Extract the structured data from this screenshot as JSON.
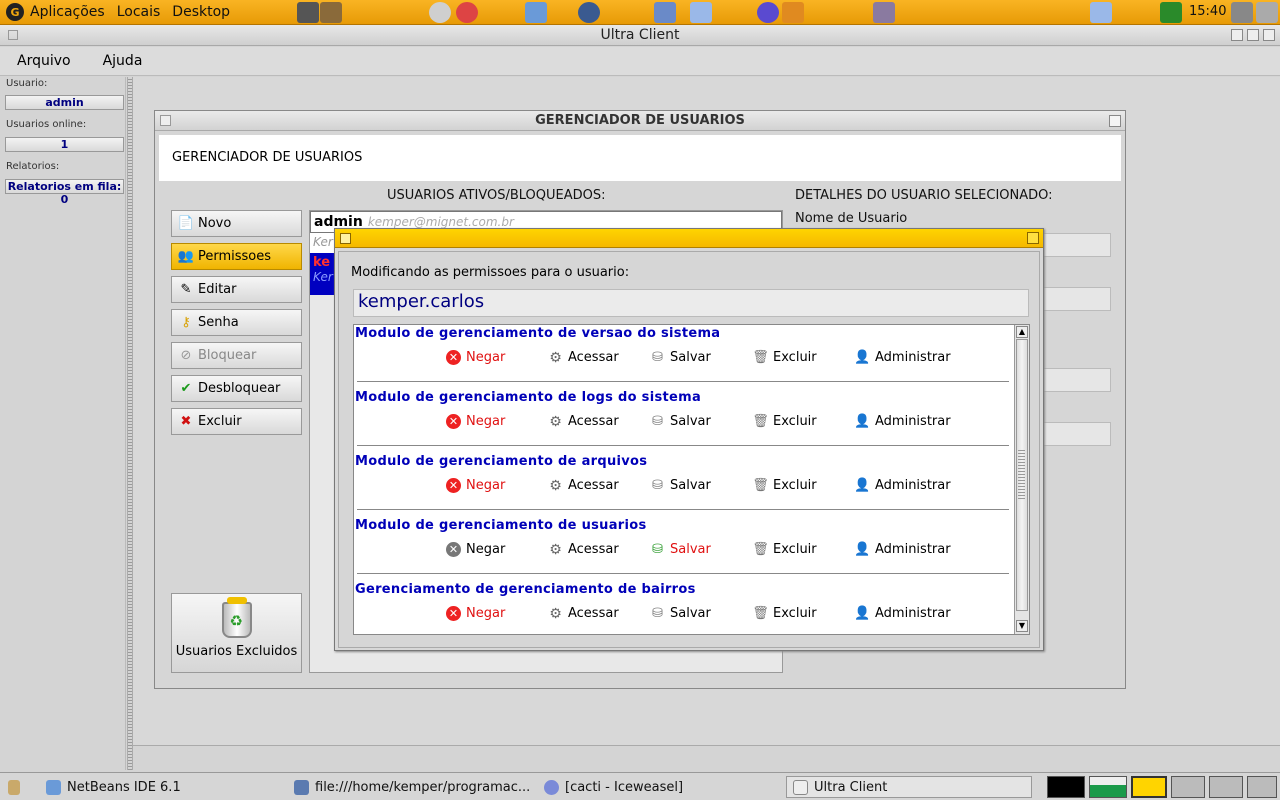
{
  "top_panel": {
    "menus": [
      "Aplicações",
      "Locais",
      "Desktop"
    ],
    "clock": "15:40"
  },
  "app": {
    "title": "Ultra Client",
    "menus": [
      "Arquivo",
      "Ajuda"
    ]
  },
  "left_panel": {
    "usuario_label": "Usuario:",
    "usuario_value": "admin",
    "online_label": "Usuarios online:",
    "online_value": "1",
    "relatorios_label": "Relatorios:",
    "relatorios_value": "Relatorios em fila: 0"
  },
  "manager": {
    "title": "GERENCIADOR DE USUARIOS",
    "header": "GERENCIADOR DE USUARIOS",
    "list_label": "USUARIOS ATIVOS/BLOQUEADOS:",
    "details_label": "DETALHES DO USUARIO SELECIONADO:",
    "nome_label": "Nome de Usuario",
    "buttons": {
      "novo": "Novo",
      "permissoes": "Permissoes",
      "editar": "Editar",
      "senha": "Senha",
      "bloquear": "Bloquear",
      "desbloquear": "Desbloquear",
      "excluir": "Excluir",
      "excluidos": "Usuarios Excluidos"
    },
    "users": [
      {
        "name": "admin",
        "email": "kemper@mignet.com.br",
        "sub": "Ker"
      },
      {
        "name": "ke",
        "sub": "Ker"
      }
    ]
  },
  "permissions": {
    "label": "Modificando as permissoes para o usuario:",
    "user": "kemper.carlos",
    "modules": [
      {
        "title": "Modulo de gerenciamento de versao do sistema",
        "selected": "Negar"
      },
      {
        "title": "Modulo de gerenciamento de logs do sistema",
        "selected": "Negar"
      },
      {
        "title": "Modulo de gerenciamento de arquivos",
        "selected": "Negar"
      },
      {
        "title": "Modulo de gerenciamento de usuarios",
        "selected": "Salvar"
      },
      {
        "title": "Gerenciamento de gerenciamento de bairros",
        "selected": "Negar"
      }
    ],
    "options": {
      "negar": "Negar",
      "acessar": "Acessar",
      "salvar": "Salvar",
      "excluir": "Excluir",
      "administrar": "Administrar"
    }
  },
  "taskbar": {
    "tasks": [
      "NetBeans IDE 6.1",
      "file:///home/kemper/programac...",
      "[cacti - Iceweasel]",
      "Ultra Client"
    ]
  }
}
